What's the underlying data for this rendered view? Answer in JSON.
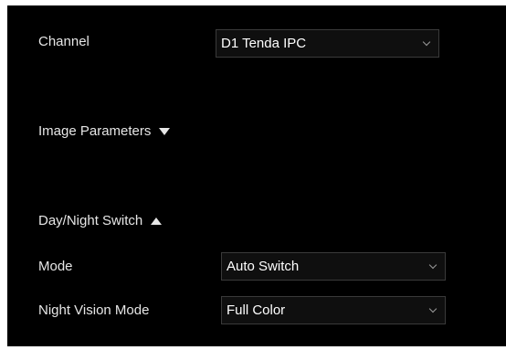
{
  "channel": {
    "label": "Channel",
    "value": "D1 Tenda IPC"
  },
  "image_parameters": {
    "label": "Image Parameters",
    "expanded": false
  },
  "day_night_switch": {
    "label": "Day/Night Switch",
    "expanded": true
  },
  "mode": {
    "label": "Mode",
    "value": "Auto Switch"
  },
  "night_vision_mode": {
    "label": "Night Vision Mode",
    "value": "Full Color"
  },
  "icons": {
    "image_parameters_toggle": "caret-down-icon",
    "day_night_toggle": "caret-up-icon",
    "dropdown": "chevron-down-icon"
  },
  "colors": {
    "panel_background": "#000000",
    "text": "#e6e6e6",
    "field_background": "#0f0f0f",
    "field_border": "#3a3a3a"
  }
}
